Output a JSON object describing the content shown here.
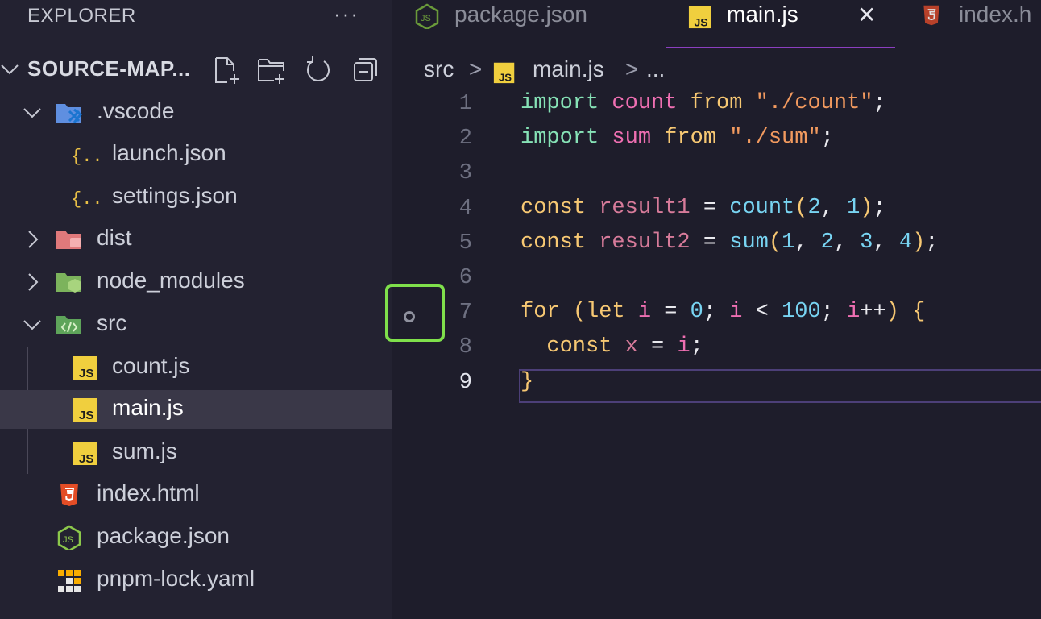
{
  "sidebar": {
    "header": "EXPLORER",
    "more": "···",
    "project_title": "SOURCE-MAP...",
    "tree": [
      {
        "label": ".vscode",
        "icon": "vscode-folder-icon"
      },
      {
        "label": "launch.json",
        "icon": "json-braces-icon"
      },
      {
        "label": "settings.json",
        "icon": "json-braces-icon"
      },
      {
        "label": "dist",
        "icon": "dist-folder-icon"
      },
      {
        "label": "node_modules",
        "icon": "node-folder-icon"
      },
      {
        "label": "src",
        "icon": "src-folder-icon"
      },
      {
        "label": "count.js",
        "icon": "js-file-icon"
      },
      {
        "label": "main.js",
        "icon": "js-file-icon"
      },
      {
        "label": "sum.js",
        "icon": "js-file-icon"
      },
      {
        "label": "index.html",
        "icon": "html5-icon"
      },
      {
        "label": "package.json",
        "icon": "nodejs-icon"
      },
      {
        "label": "pnpm-lock.yaml",
        "icon": "pnpm-icon"
      }
    ]
  },
  "tabs": [
    {
      "label": "package.json",
      "icon": "nodejs-icon",
      "active": false
    },
    {
      "label": "main.js",
      "icon": "js-file-icon",
      "active": true,
      "close": "✕"
    },
    {
      "label": "index.h",
      "icon": "html5-icon",
      "active": false
    }
  ],
  "breadcrumb": {
    "folder": "src",
    "sep": ">",
    "file": "main.js",
    "more": "..."
  },
  "line_numbers": [
    "1",
    "2",
    "3",
    "4",
    "5",
    "6",
    "7",
    "8",
    "9"
  ],
  "code": [
    [
      [
        "kw",
        "import"
      ],
      [
        "punc",
        " "
      ],
      [
        "var",
        "count"
      ],
      [
        "punc",
        " "
      ],
      [
        "kw2",
        "from"
      ],
      [
        "punc",
        " "
      ],
      [
        "str",
        "\"./count\""
      ],
      [
        "punc",
        ";"
      ]
    ],
    [
      [
        "kw",
        "import"
      ],
      [
        "punc",
        " "
      ],
      [
        "var",
        "sum"
      ],
      [
        "punc",
        " "
      ],
      [
        "kw2",
        "from"
      ],
      [
        "punc",
        " "
      ],
      [
        "str",
        "\"./sum\""
      ],
      [
        "punc",
        ";"
      ]
    ],
    [],
    [
      [
        "kw2",
        "const"
      ],
      [
        "punc",
        " "
      ],
      [
        "var2",
        "result1"
      ],
      [
        "punc",
        " = "
      ],
      [
        "fn",
        "count"
      ],
      [
        "paren",
        "("
      ],
      [
        "num",
        "2"
      ],
      [
        "punc",
        ", "
      ],
      [
        "num",
        "1"
      ],
      [
        "paren",
        ")"
      ],
      [
        "punc",
        ";"
      ]
    ],
    [
      [
        "kw2",
        "const"
      ],
      [
        "punc",
        " "
      ],
      [
        "var2",
        "result2"
      ],
      [
        "punc",
        " = "
      ],
      [
        "fn",
        "sum"
      ],
      [
        "paren",
        "("
      ],
      [
        "num",
        "1"
      ],
      [
        "punc",
        ", "
      ],
      [
        "num",
        "2"
      ],
      [
        "punc",
        ", "
      ],
      [
        "num",
        "3"
      ],
      [
        "punc",
        ", "
      ],
      [
        "num",
        "4"
      ],
      [
        "paren",
        ")"
      ],
      [
        "punc",
        ";"
      ]
    ],
    [],
    [
      [
        "kw2",
        "for"
      ],
      [
        "punc",
        " "
      ],
      [
        "paren",
        "("
      ],
      [
        "kw2",
        "let"
      ],
      [
        "punc",
        " "
      ],
      [
        "var",
        "i"
      ],
      [
        "punc",
        " = "
      ],
      [
        "num",
        "0"
      ],
      [
        "punc",
        "; "
      ],
      [
        "var",
        "i"
      ],
      [
        "punc",
        " < "
      ],
      [
        "num",
        "100"
      ],
      [
        "punc",
        "; "
      ],
      [
        "var",
        "i"
      ],
      [
        "punc",
        "++"
      ],
      [
        "paren",
        ")"
      ],
      [
        "punc",
        " "
      ],
      [
        "paren",
        "{"
      ]
    ],
    [
      [
        "punc",
        "  "
      ],
      [
        "kw2",
        "const"
      ],
      [
        "punc",
        " "
      ],
      [
        "var2",
        "x"
      ],
      [
        "punc",
        " = "
      ],
      [
        "var",
        "i"
      ],
      [
        "punc",
        ";"
      ]
    ],
    [
      [
        "paren",
        "}"
      ]
    ]
  ],
  "colors": {
    "accent_tab_underline": "#8b3fbf",
    "highlight_box": "#7fe04b"
  }
}
